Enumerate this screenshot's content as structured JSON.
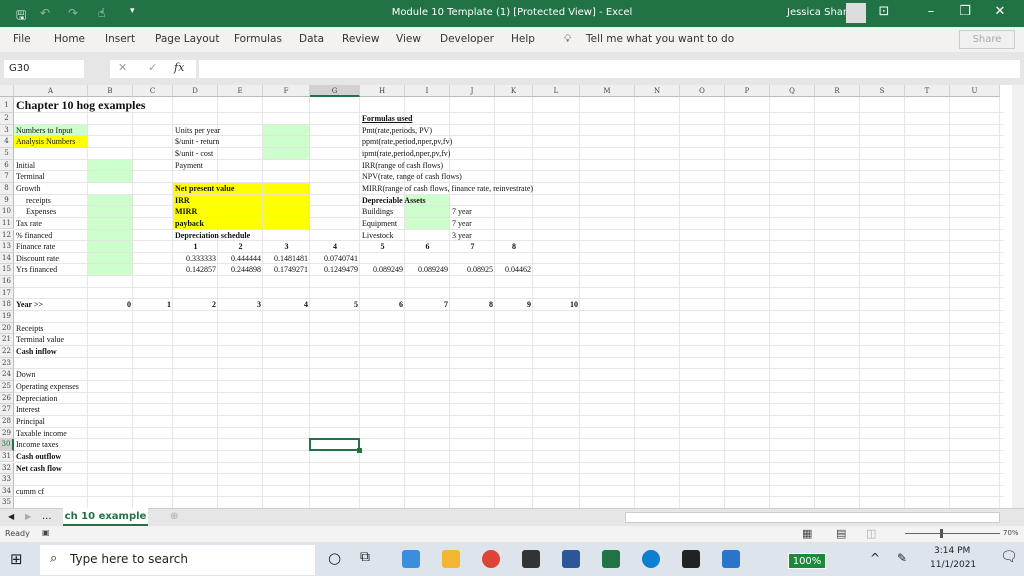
{
  "window": {
    "title": "Module 10 Template (1)  [Protected View]  -  Excel",
    "user": "Jessica Sharp"
  },
  "menu": {
    "items": [
      "File",
      "Home",
      "Insert",
      "Page Layout",
      "Formulas",
      "Data",
      "Review",
      "View",
      "Developer",
      "Help"
    ],
    "tell_me": "Tell me what you want to do",
    "share": "Share"
  },
  "formula_bar": {
    "name_box": "G30",
    "fx": "fx",
    "value": ""
  },
  "columns": [
    "A",
    "B",
    "C",
    "D",
    "E",
    "F",
    "G",
    "H",
    "I",
    "J",
    "K",
    "L",
    "M",
    "N",
    "O",
    "P",
    "Q",
    "R",
    "S",
    "T",
    "U"
  ],
  "selected_cell": "G30",
  "fill_colors": {
    "green": "#ccffcc",
    "yellow": "#ffff00",
    "accent": "#217346"
  },
  "fills": [
    {
      "range": "A3:A3",
      "color": "green"
    },
    {
      "range": "A4:A4",
      "color": "yellow"
    },
    {
      "range": "B6:B7",
      "color": "green"
    },
    {
      "range": "B9:B15",
      "color": "green"
    },
    {
      "range": "F3:F5",
      "color": "green"
    },
    {
      "range": "D8:F11",
      "color": "yellow"
    },
    {
      "range": "I9:I11",
      "color": "green"
    }
  ],
  "cells": [
    {
      "ref": "A1",
      "text": "Chapter 10 hog examples",
      "bold": true,
      "big": true
    },
    {
      "ref": "A3",
      "text": "Numbers to Input"
    },
    {
      "ref": "A4",
      "text": "Analysis Numbers"
    },
    {
      "ref": "A6",
      "text": "Initial"
    },
    {
      "ref": "A7",
      "text": "Terminal"
    },
    {
      "ref": "A8",
      "text": "Growth"
    },
    {
      "ref": "A9",
      "text": "receipts",
      "indent": true
    },
    {
      "ref": "A10",
      "text": "Expenses",
      "indent": true
    },
    {
      "ref": "A11",
      "text": "Tax rate"
    },
    {
      "ref": "A12",
      "text": "% financed"
    },
    {
      "ref": "A13",
      "text": "Finance rate"
    },
    {
      "ref": "A14",
      "text": "Discount rate"
    },
    {
      "ref": "A15",
      "text": "Yrs financed"
    },
    {
      "ref": "D3",
      "text": "Units per year"
    },
    {
      "ref": "D4",
      "text": "$/unit - return"
    },
    {
      "ref": "D5",
      "text": "$/unit - cost"
    },
    {
      "ref": "D6",
      "text": "Payment"
    },
    {
      "ref": "D8",
      "text": "Net present value",
      "bold": true
    },
    {
      "ref": "D9",
      "text": "IRR",
      "bold": true
    },
    {
      "ref": "D10",
      "text": "MIRR",
      "bold": true
    },
    {
      "ref": "D11",
      "text": "payback",
      "bold": true
    },
    {
      "ref": "D12",
      "text": "Depreciation schedule",
      "bold": true
    },
    {
      "ref": "D13",
      "text": "1",
      "bold": true,
      "align": "center"
    },
    {
      "ref": "E13",
      "text": "2",
      "bold": true,
      "align": "center"
    },
    {
      "ref": "F13",
      "text": "3",
      "bold": true,
      "align": "center"
    },
    {
      "ref": "G13",
      "text": "4",
      "bold": true,
      "align": "center"
    },
    {
      "ref": "H13",
      "text": "5",
      "bold": true,
      "align": "center"
    },
    {
      "ref": "I13",
      "text": "6",
      "bold": true,
      "align": "center"
    },
    {
      "ref": "J13",
      "text": "7",
      "bold": true,
      "align": "center"
    },
    {
      "ref": "K13",
      "text": "8",
      "bold": true,
      "align": "center"
    },
    {
      "ref": "D14",
      "text": "0.333333",
      "align": "right"
    },
    {
      "ref": "E14",
      "text": "0.444444",
      "align": "right"
    },
    {
      "ref": "F14",
      "text": "0.1481481",
      "align": "right"
    },
    {
      "ref": "G14",
      "text": "0.0740741",
      "align": "right"
    },
    {
      "ref": "D15",
      "text": "0.142857",
      "align": "right"
    },
    {
      "ref": "E15",
      "text": "0.244898",
      "align": "right"
    },
    {
      "ref": "F15",
      "text": "0.1749271",
      "align": "right"
    },
    {
      "ref": "G15",
      "text": "0.1249479",
      "align": "right"
    },
    {
      "ref": "H15",
      "text": "0.089249",
      "align": "right"
    },
    {
      "ref": "I15",
      "text": "0.089249",
      "align": "right"
    },
    {
      "ref": "J15",
      "text": "0.08925",
      "align": "right"
    },
    {
      "ref": "K15",
      "text": "0.04462",
      "align": "right"
    },
    {
      "ref": "H2",
      "text": "Formulas used",
      "bold": true,
      "underline": true
    },
    {
      "ref": "H3",
      "text": "Pmt(rate,periods, PV)"
    },
    {
      "ref": "H4",
      "text": "ppmt(rate,period,nper,pv,fv)"
    },
    {
      "ref": "H5",
      "text": "ipmt(rate,period,nper,pv,fv)"
    },
    {
      "ref": "H6",
      "text": "IRR(range of cash flows)"
    },
    {
      "ref": "H7",
      "text": "NPV(rate, range of cash flows)"
    },
    {
      "ref": "H8",
      "text": "MIRR(range of cash flows, finance rate, reinvestrate)"
    },
    {
      "ref": "H9",
      "text": "Depreciable Assets",
      "bold": true
    },
    {
      "ref": "H10",
      "text": "Buildings"
    },
    {
      "ref": "H11",
      "text": "Equipment"
    },
    {
      "ref": "H12",
      "text": "Livestock"
    },
    {
      "ref": "J10",
      "text": "7 year"
    },
    {
      "ref": "J11",
      "text": "7 year"
    },
    {
      "ref": "J12",
      "text": "3 year"
    },
    {
      "ref": "A18",
      "text": "Year >>",
      "bold": true
    },
    {
      "ref": "B18",
      "text": "0",
      "bold": true,
      "align": "right"
    },
    {
      "ref": "C18",
      "text": "1",
      "bold": true,
      "align": "right"
    },
    {
      "ref": "D18",
      "text": "2",
      "bold": true,
      "align": "right"
    },
    {
      "ref": "E18",
      "text": "3",
      "bold": true,
      "align": "right"
    },
    {
      "ref": "F18",
      "text": "4",
      "bold": true,
      "align": "right"
    },
    {
      "ref": "G18",
      "text": "5",
      "bold": true,
      "align": "right"
    },
    {
      "ref": "H18",
      "text": "6",
      "bold": true,
      "align": "right"
    },
    {
      "ref": "I18",
      "text": "7",
      "bold": true,
      "align": "right"
    },
    {
      "ref": "J18",
      "text": "8",
      "bold": true,
      "align": "right"
    },
    {
      "ref": "K18",
      "text": "9",
      "bold": true,
      "align": "right"
    },
    {
      "ref": "L18",
      "text": "10",
      "bold": true,
      "align": "right"
    },
    {
      "ref": "A20",
      "text": "Receipts"
    },
    {
      "ref": "A21",
      "text": "Terminal value"
    },
    {
      "ref": "A22",
      "text": "Cash inflow",
      "bold": true
    },
    {
      "ref": "A24",
      "text": "Down"
    },
    {
      "ref": "A25",
      "text": "Operating expenses"
    },
    {
      "ref": "A26",
      "text": "Depreciation"
    },
    {
      "ref": "A27",
      "text": "Interest"
    },
    {
      "ref": "A28",
      "text": "Principal"
    },
    {
      "ref": "A29",
      "text": "Taxable income"
    },
    {
      "ref": "A30",
      "text": "Income taxes"
    },
    {
      "ref": "A31",
      "text": "Cash outflow",
      "bold": true
    },
    {
      "ref": "A32",
      "text": "Net cash flow",
      "bold": true
    },
    {
      "ref": "A34",
      "text": "cumm cf"
    }
  ],
  "sheet_tabs": {
    "active": "ch 10 example",
    "more": "..."
  },
  "status": {
    "ready": "Ready",
    "zoom": "70%"
  },
  "taskbar": {
    "search_placeholder": "Type here to search",
    "battery": "100%",
    "time": "3:14 PM",
    "date": "11/1/2021"
  }
}
